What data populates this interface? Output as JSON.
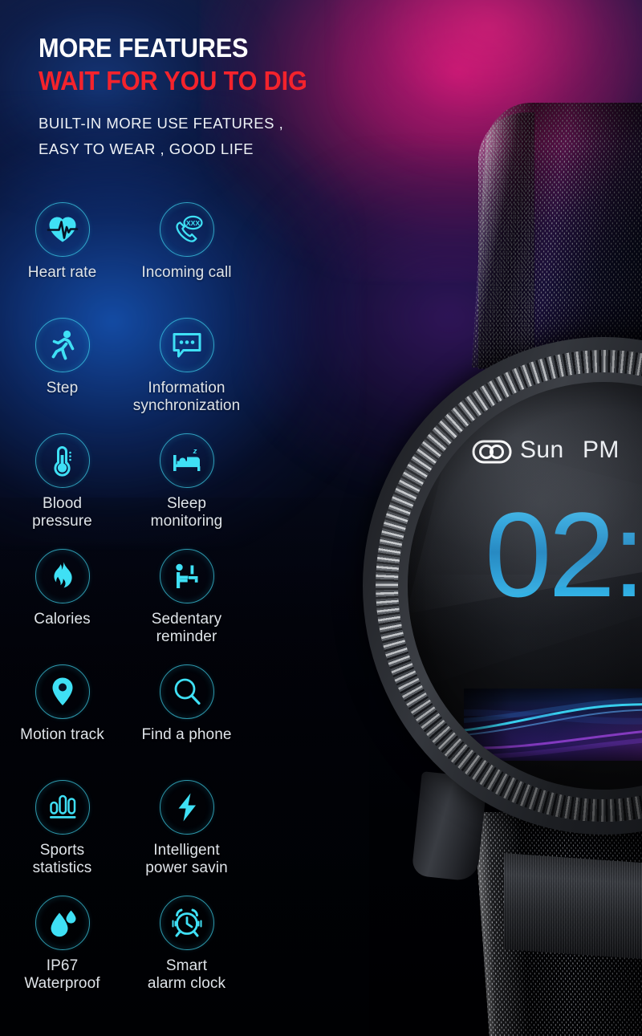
{
  "headline": {
    "line1": "MORE FEATURES",
    "line2": "WAIT FOR YOU TO DIG",
    "sub_line1": "BUILT-IN MORE USE FEATURES ,",
    "sub_line2": "EASY TO WEAR , GOOD LIFE"
  },
  "colors": {
    "headline_white": "#ffffff",
    "headline_red": "#f4232c",
    "icon_cyan": "#3fe0f5",
    "ring_cyan": "#40d6ee",
    "label_gray": "#dfe4e9",
    "time_blue": "#2ea8e0",
    "bg_magenta": "#d61678",
    "bg_blue": "#1656ba"
  },
  "features": [
    {
      "icon": "heart-rate-icon",
      "label": "Heart rate"
    },
    {
      "icon": "incoming-call-icon",
      "label": "Incoming call",
      "badge": "XXX"
    },
    {
      "icon": "step-icon",
      "label": "Step"
    },
    {
      "icon": "information-sync-icon",
      "label": "Information\nsynchronization"
    },
    {
      "icon": "blood-pressure-icon",
      "label": "Blood\npressure"
    },
    {
      "icon": "sleep-monitoring-icon",
      "label": "Sleep\nmonitoring",
      "badge": "z"
    },
    {
      "icon": "calories-icon",
      "label": "Calories"
    },
    {
      "icon": "sedentary-reminder-icon",
      "label": "Sedentary\nreminder"
    },
    {
      "icon": "motion-track-icon",
      "label": "Motion track"
    },
    {
      "icon": "find-a-phone-icon",
      "label": "Find a phone"
    },
    {
      "icon": "sports-statistics-icon",
      "label": "Sports\nstatistics"
    },
    {
      "icon": "intelligent-power-saving-icon",
      "label": "Intelligent\npower savin"
    },
    {
      "icon": "ip67-waterproof-icon",
      "label": "IP67\nWaterproof"
    },
    {
      "icon": "smart-alarm-clock-icon",
      "label": "Smart\nalarm clock"
    }
  ],
  "watch": {
    "bluetooth_icon": "bluetooth-link-icon",
    "day": "Sun",
    "meridiem": "PM",
    "time": "02:"
  }
}
